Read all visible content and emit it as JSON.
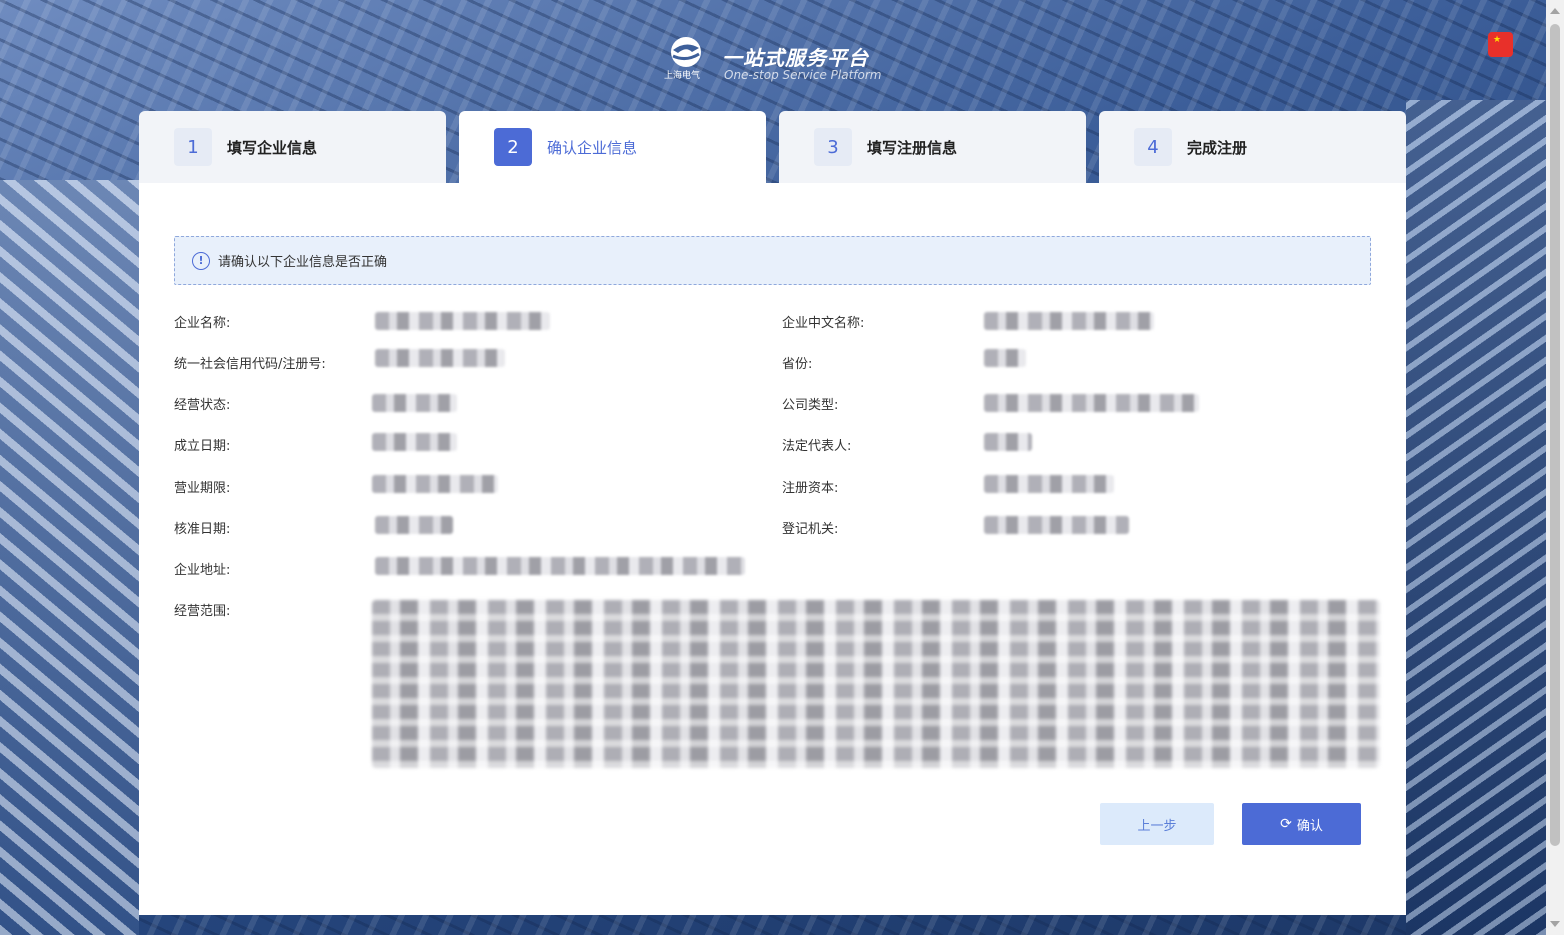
{
  "brand": {
    "name_cn": "一站式服务平台",
    "name_en": "One-stop Service Platform",
    "company_cn": "上海电气"
  },
  "language_flag": "★",
  "steps": [
    {
      "num": "1",
      "label": "填写企业信息"
    },
    {
      "num": "2",
      "label": "确认企业信息"
    },
    {
      "num": "3",
      "label": "填写注册信息"
    },
    {
      "num": "4",
      "label": "完成注册"
    }
  ],
  "notice": {
    "icon": "!",
    "text": "请确认以下企业信息是否正确"
  },
  "fields": {
    "company_name": "企业名称:",
    "company_cn_name": "企业中文名称:",
    "credit_code": "统一社会信用代码/注册号:",
    "province": "省份:",
    "status": "经营状态:",
    "company_type": "公司类型:",
    "founded": "成立日期:",
    "legal_rep": "法定代表人:",
    "term": "营业期限:",
    "capital": "注册资本:",
    "approval_date": "核准日期:",
    "authority": "登记机关:",
    "address": "企业地址:",
    "scope": "经营范围:"
  },
  "buttons": {
    "prev": "上一步",
    "confirm": "确认",
    "confirm_icon": "⟳"
  },
  "colors": {
    "primary": "#4c6bd6",
    "notice_bg": "#e8f0fb",
    "prev_bg": "#dceafb"
  }
}
